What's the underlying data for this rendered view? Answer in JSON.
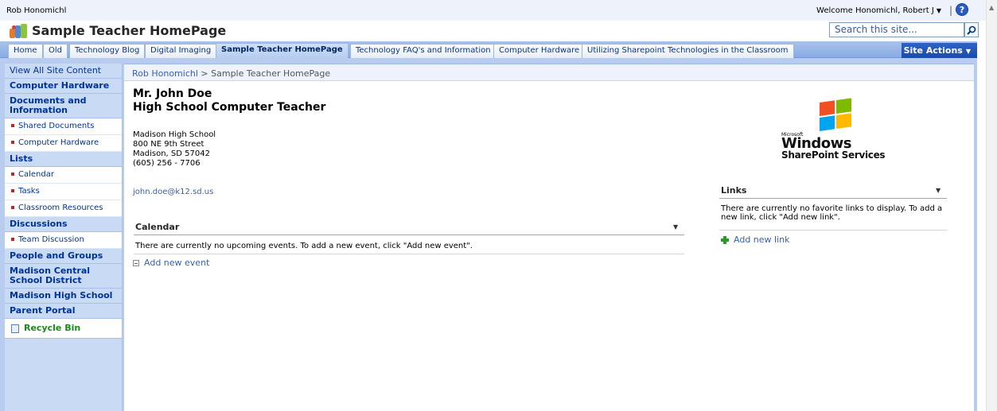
{
  "topbar": {
    "site_crumb": "Rob Honomichl",
    "welcome": "Welcome Honomichl, Robert J",
    "separator": "|",
    "help_symbol": "?"
  },
  "header": {
    "title": "Sample Teacher HomePage",
    "search_placeholder": "Search this site...",
    "search_icon": "magnifier-icon"
  },
  "tabs": [
    {
      "label": "Home"
    },
    {
      "label": "Old"
    },
    {
      "label": "Technology Blog"
    },
    {
      "label": "Digital Imaging"
    },
    {
      "label": "Sample Teacher HomePage",
      "active": true
    },
    {
      "label": "Technology FAQ's and Information"
    },
    {
      "label": "Computer Hardware"
    },
    {
      "label": "Utilizing Sharepoint Technologies in the Classroom"
    }
  ],
  "site_actions": {
    "label": "Site Actions"
  },
  "leftnav": {
    "view_all": "View All Site Content",
    "computer_hardware": "Computer Hardware",
    "documents_heading": "Documents and Information",
    "documents_items": [
      "Shared Documents",
      "Computer Hardware"
    ],
    "lists_heading": "Lists",
    "lists_items": [
      "Calendar",
      "Tasks",
      "Classroom Resources"
    ],
    "discussions_heading": "Discussions",
    "discussions_items": [
      "Team Discussion"
    ],
    "people_groups": "People and Groups",
    "madison_central": "Madison Central School District",
    "madison_high": "Madison High School",
    "parent_portal": "Parent Portal",
    "recycle_bin": "Recycle Bin"
  },
  "breadcrumb": {
    "root": "Rob Honomichl",
    "separator": ">",
    "current": "Sample Teacher HomePage"
  },
  "profile": {
    "name": "Mr. John Doe",
    "role": "High School Computer Teacher",
    "address_lines": [
      "Madison High School",
      "800 NE 9th Street",
      "Madison, SD 57042",
      "(605) 256 - 7706"
    ],
    "email": "john.doe@k12.sd.us"
  },
  "calendar": {
    "title": "Calendar",
    "message": "There are currently no upcoming events. To add a new event, click \"Add new event\".",
    "add_label": "Add new event"
  },
  "links": {
    "title": "Links",
    "message": "There are currently no favorite links to display. To add a new link, click \"Add new link\".",
    "add_label": "Add new link"
  },
  "logo": {
    "microsoft": "Microsoft",
    "windows": "Windows",
    "sharepoint": "SharePoint Services",
    "colors": {
      "red": "#f25022",
      "green": "#7fba00",
      "blue": "#00a4ef",
      "yellow": "#ffb900"
    }
  },
  "colors": {
    "accent": "#003399",
    "site_actions_bg": "#1a4cab",
    "nav_bg": "#c8daf4",
    "tabbar_bg": "#89ace4"
  }
}
